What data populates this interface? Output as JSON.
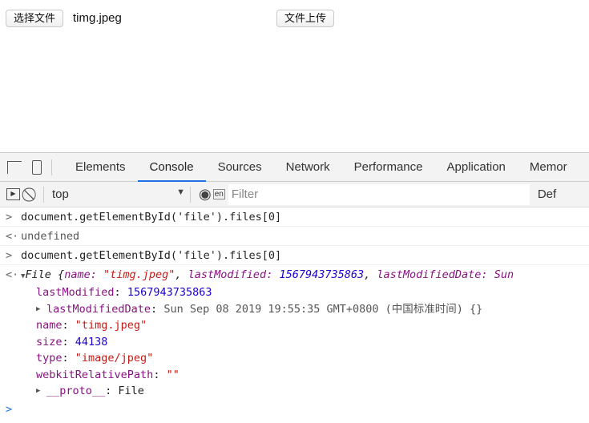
{
  "page": {
    "choose_file": "选择文件",
    "file_name": "timg.jpeg",
    "upload": "文件上传"
  },
  "devtools": {
    "tabs": [
      "Elements",
      "Console",
      "Sources",
      "Network",
      "Performance",
      "Application",
      "Memor"
    ],
    "context": "top",
    "filter_placeholder": "Filter",
    "levels": "Def"
  },
  "console": {
    "cmd1": "document.getElementById('file').files[0]",
    "res1": "undefined",
    "cmd2": "document.getElementById('file').files[0]",
    "summary": {
      "prefix": "File {",
      "k1": "name: ",
      "v1": "\"timg.jpeg\"",
      "c1": ", ",
      "k2": "lastModified: ",
      "v2": "1567943735863",
      "c2": ", ",
      "k3": "lastModifiedDate: Sun"
    },
    "props": [
      {
        "key": "lastModified",
        "value": "1567943735863",
        "type": "n"
      },
      {
        "key": "lastModifiedDate",
        "value": "Sun Sep 08 2019 19:55:35 GMT+0800 (中国标准时间) {}",
        "type": "g"
      },
      {
        "key": "name",
        "value": "\"timg.jpeg\"",
        "type": "s"
      },
      {
        "key": "size",
        "value": "44138",
        "type": "n"
      },
      {
        "key": "type",
        "value": "\"image/jpeg\"",
        "type": "s"
      },
      {
        "key": "webkitRelativePath",
        "value": "\"\"",
        "type": "s"
      },
      {
        "key": "__proto__",
        "value": "File",
        "type": "x"
      }
    ]
  }
}
